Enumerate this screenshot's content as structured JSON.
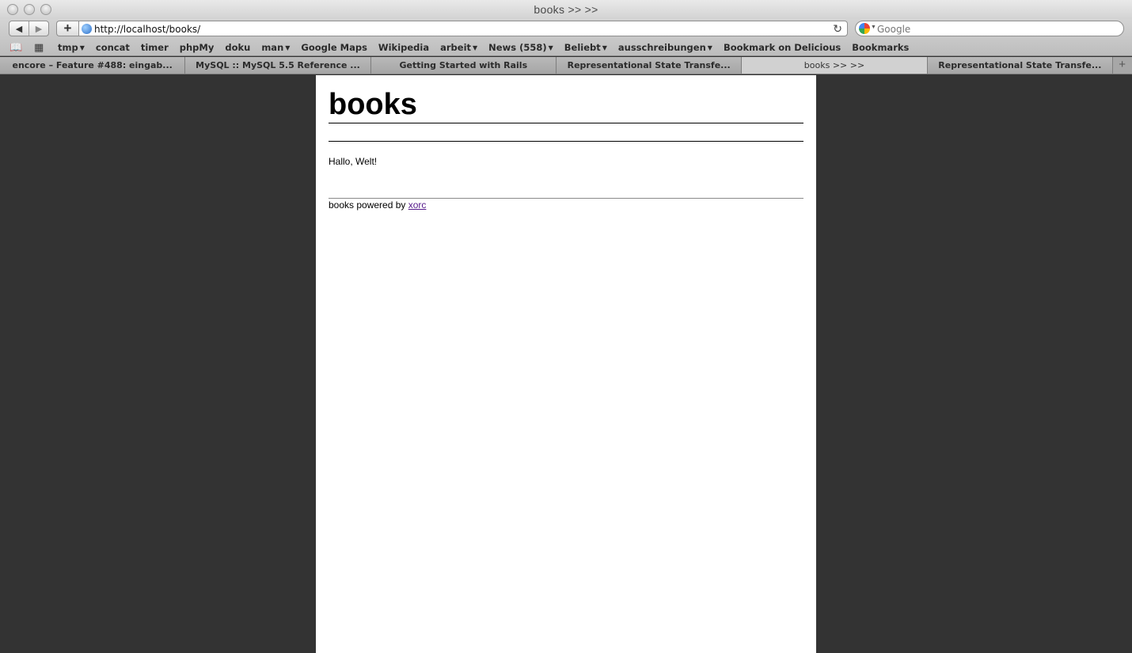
{
  "window": {
    "title": "books >> >>"
  },
  "toolbar": {
    "url": "http://localhost/books/",
    "search_placeholder": "Google"
  },
  "bookmarks": [
    {
      "label": "tmp",
      "menu": true
    },
    {
      "label": "concat",
      "menu": false
    },
    {
      "label": "timer",
      "menu": false
    },
    {
      "label": "phpMy",
      "menu": false
    },
    {
      "label": "doku",
      "menu": false
    },
    {
      "label": "man",
      "menu": true
    },
    {
      "label": "Google Maps",
      "menu": false
    },
    {
      "label": "Wikipedia",
      "menu": false
    },
    {
      "label": "arbeit",
      "menu": true
    },
    {
      "label": "News (558)",
      "menu": true
    },
    {
      "label": "Beliebt",
      "menu": true
    },
    {
      "label": "ausschreibungen",
      "menu": true
    },
    {
      "label": "Bookmark on Delicious",
      "menu": false
    },
    {
      "label": "Bookmarks",
      "menu": false
    }
  ],
  "tabs": [
    {
      "label": "encore – Feature #488: eingab...",
      "active": false
    },
    {
      "label": "MySQL :: MySQL 5.5 Reference ...",
      "active": false
    },
    {
      "label": "Getting Started with Rails",
      "active": false
    },
    {
      "label": "Representational State Transfe...",
      "active": false
    },
    {
      "label": "books >> >>",
      "active": true
    },
    {
      "label": "Representational State Transfe...",
      "active": false
    }
  ],
  "page": {
    "heading": "books",
    "greeting": "Hallo, Welt!",
    "footer_text": "books powered by ",
    "footer_link": "xorc"
  },
  "colors": {
    "page_background": "#333333",
    "content_background": "#ffffff",
    "visited_link": "#551a8b"
  }
}
